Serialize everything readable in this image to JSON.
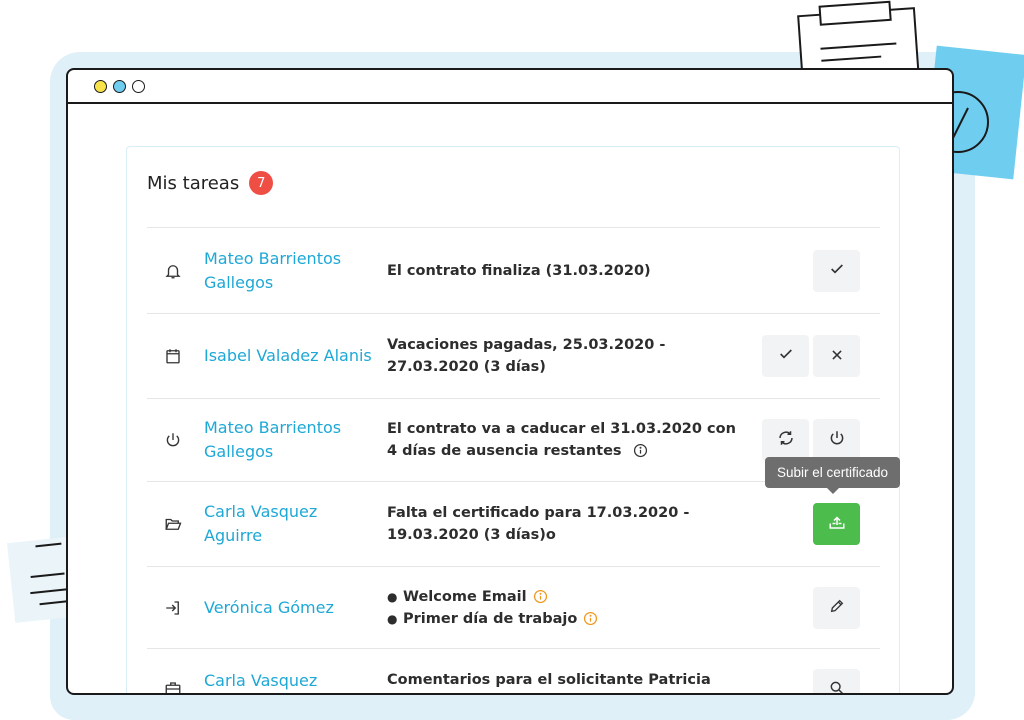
{
  "panel": {
    "title": "Mis tareas",
    "badge_count": "7"
  },
  "colors": {
    "accent": "#1ea8d6",
    "badge": "#ef4e45",
    "success": "#4cbc4c",
    "info": "#f0961e"
  },
  "tooltip": {
    "text": "Subir el certificado"
  },
  "tasks": [
    {
      "icon": "bell-icon",
      "name": "Mateo Barrientos Gallegos",
      "description": "El contrato finaliza (31.03.2020)",
      "actions": [
        "check-icon"
      ]
    },
    {
      "icon": "calendar-icon",
      "name": "Isabel Valadez Alanis",
      "description": "Vacaciones pagadas, 25.03.2020 - 27.03.2020 (3 días)",
      "actions": [
        "check-icon",
        "close-icon"
      ]
    },
    {
      "icon": "power-icon",
      "name": "Mateo Barrientos Gallegos",
      "description": "El contrato va a caducar el 31.03.2020 con 4 días de ausencia restantes",
      "actions": [
        "refresh-icon",
        "power-icon"
      ]
    },
    {
      "icon": "folder-open-icon",
      "name": "Carla Vasquez Aguirre",
      "description": "Falta el certificado para 17.03.2020 - 19.03.2020 (3 días)o",
      "actions": [
        "upload-icon"
      ]
    },
    {
      "icon": "sign-in-icon",
      "name": "Verónica Gómez",
      "items": [
        "Welcome Email",
        "Primer día de trabajo"
      ],
      "actions": [
        "pencil-icon"
      ]
    },
    {
      "icon": "briefcase-icon",
      "name": "Carla Vasquez Aguirre",
      "description": "Comentarios para el solicitante Patricia",
      "actions": [
        "search-icon"
      ]
    }
  ]
}
